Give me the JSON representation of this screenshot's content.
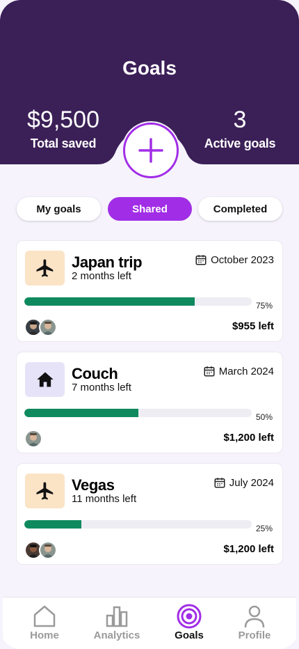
{
  "header": {
    "title": "Goals",
    "total_saved_value": "$9,500",
    "total_saved_label": "Total saved",
    "active_goals_value": "3",
    "active_goals_label": "Active goals"
  },
  "tabs": [
    {
      "label": "My goals",
      "active": false
    },
    {
      "label": "Shared",
      "active": true
    },
    {
      "label": "Completed",
      "active": false
    }
  ],
  "goals": [
    {
      "name": "Japan trip",
      "remaining": "2 months left",
      "date": "October 2023",
      "progress": 0.75,
      "progress_label": "75%",
      "amount_left": "$955 left",
      "icon": "airplane-icon",
      "thumb_color": "#fbe3c6"
    },
    {
      "name": "Couch",
      "remaining": "7 months left",
      "date": "March 2024",
      "progress": 0.5,
      "progress_label": "50%",
      "amount_left": "$1,200 left",
      "icon": "house-icon",
      "thumb_color": "#e6e3f8"
    },
    {
      "name": "Vegas",
      "remaining": "11 months left",
      "date": "July 2024",
      "progress": 0.25,
      "progress_label": "25%",
      "amount_left": "$1,200 left",
      "icon": "airplane-icon",
      "thumb_color": "#fbe3c6"
    }
  ],
  "nav": [
    {
      "label": "Home",
      "icon": "home-icon",
      "active": false
    },
    {
      "label": "Analytics",
      "icon": "analytics-icon",
      "active": false
    },
    {
      "label": "Goals",
      "icon": "target-icon",
      "active": true
    },
    {
      "label": "Profile",
      "icon": "profile-icon",
      "active": false
    }
  ],
  "colors": {
    "header_bg": "#3b1f57",
    "accent": "#a12de6",
    "progress": "#0f8a5f",
    "background": "#f6f3fc"
  }
}
